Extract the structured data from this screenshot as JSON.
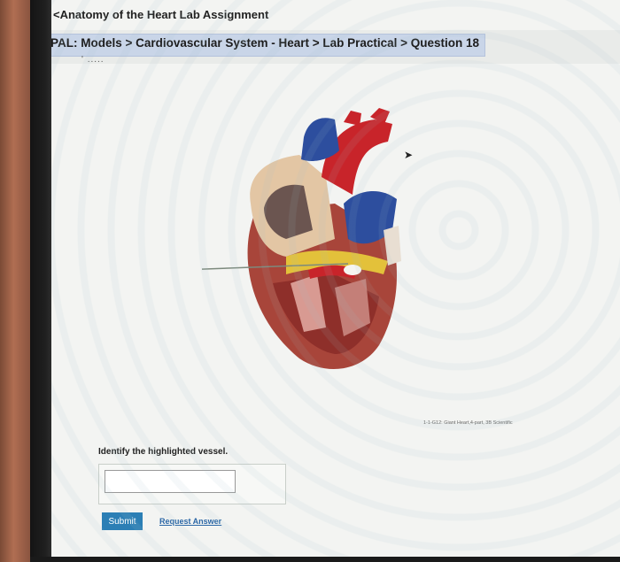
{
  "nav": {
    "back_label": "<Anatomy of the Heart Lab Assignment",
    "breadcrumb": "PAL: Models > Cardiovascular System - Heart > Lab Practical > Question 18",
    "cut_text": "' ....."
  },
  "figure": {
    "image_name": "heart-model-image",
    "credit": "1-1-G12: Giant Heart,4-part, 3B Scientific"
  },
  "question": {
    "prompt": "Identify the highlighted vessel.",
    "answer_value": "",
    "answer_placeholder": ""
  },
  "actions": {
    "submit_label": "Submit",
    "request_label": "Request Answer"
  },
  "colors": {
    "breadcrumb_bg": "#c9d5e8",
    "submit_bg": "#2c7fb5",
    "link": "#2a66a6",
    "model_red": "#c0262a",
    "model_blue": "#2d4e9e",
    "model_yellow": "#e3c13a"
  }
}
